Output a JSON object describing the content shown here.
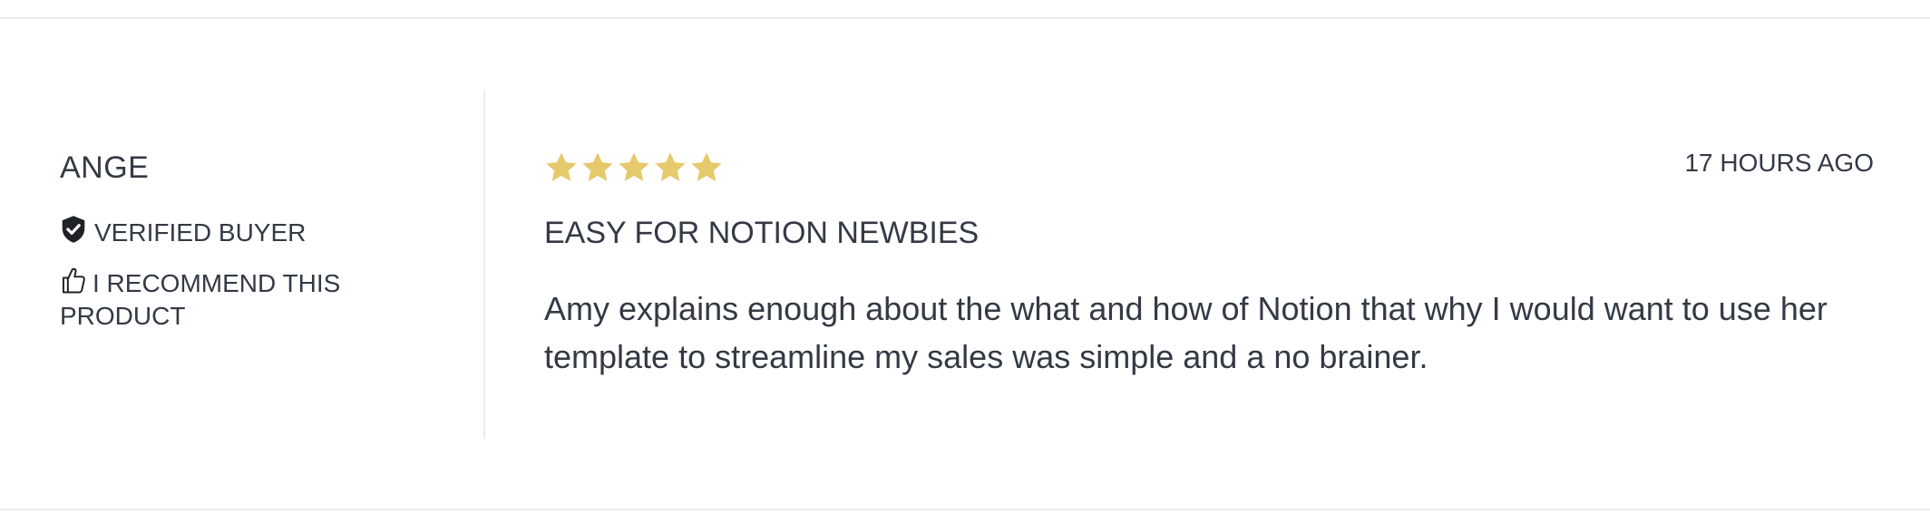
{
  "review": {
    "author": "ANGE",
    "verified_label": "VERIFIED BUYER",
    "recommend_label": "I RECOMMEND THIS PRODUCT",
    "rating": 5,
    "rating_max": 5,
    "timestamp": "17 HOURS AGO",
    "title": "EASY FOR NOTION NEWBIES",
    "body": "Amy explains enough about the what and how of Notion that why I would want to use her template to streamline my sales was simple and a no brainer."
  },
  "icons": {
    "verified": "shield-check-icon",
    "recommend": "thumbs-up-icon",
    "star": "star-icon"
  },
  "colors": {
    "text": "#333a45",
    "star": "#e6c96a",
    "divider": "#ececec"
  }
}
